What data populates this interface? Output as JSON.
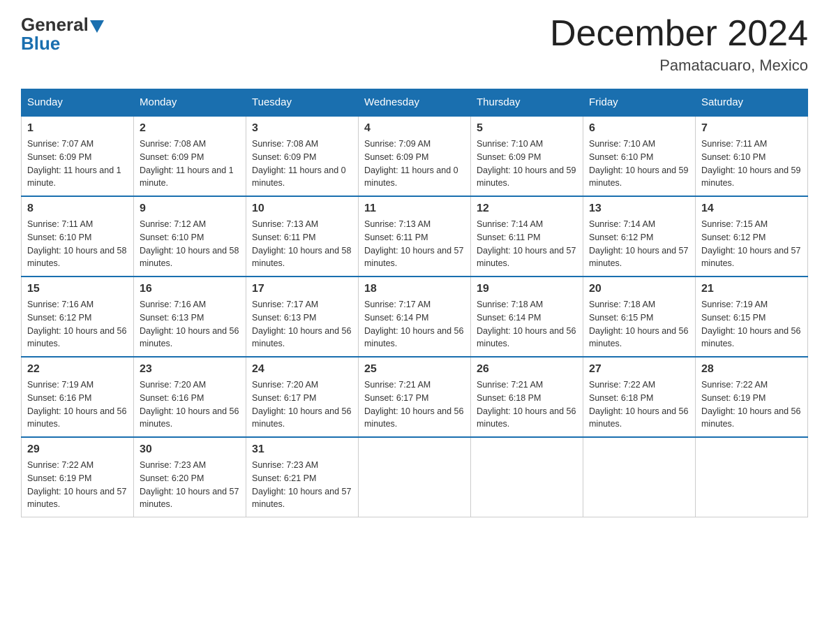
{
  "header": {
    "logo_general": "General",
    "logo_blue": "Blue",
    "month_title": "December 2024",
    "location": "Pamatacuaro, Mexico"
  },
  "days_of_week": [
    "Sunday",
    "Monday",
    "Tuesday",
    "Wednesday",
    "Thursday",
    "Friday",
    "Saturday"
  ],
  "weeks": [
    [
      {
        "day": "1",
        "sunrise": "7:07 AM",
        "sunset": "6:09 PM",
        "daylight": "11 hours and 1 minute."
      },
      {
        "day": "2",
        "sunrise": "7:08 AM",
        "sunset": "6:09 PM",
        "daylight": "11 hours and 1 minute."
      },
      {
        "day": "3",
        "sunrise": "7:08 AM",
        "sunset": "6:09 PM",
        "daylight": "11 hours and 0 minutes."
      },
      {
        "day": "4",
        "sunrise": "7:09 AM",
        "sunset": "6:09 PM",
        "daylight": "11 hours and 0 minutes."
      },
      {
        "day": "5",
        "sunrise": "7:10 AM",
        "sunset": "6:09 PM",
        "daylight": "10 hours and 59 minutes."
      },
      {
        "day": "6",
        "sunrise": "7:10 AM",
        "sunset": "6:10 PM",
        "daylight": "10 hours and 59 minutes."
      },
      {
        "day": "7",
        "sunrise": "7:11 AM",
        "sunset": "6:10 PM",
        "daylight": "10 hours and 59 minutes."
      }
    ],
    [
      {
        "day": "8",
        "sunrise": "7:11 AM",
        "sunset": "6:10 PM",
        "daylight": "10 hours and 58 minutes."
      },
      {
        "day": "9",
        "sunrise": "7:12 AM",
        "sunset": "6:10 PM",
        "daylight": "10 hours and 58 minutes."
      },
      {
        "day": "10",
        "sunrise": "7:13 AM",
        "sunset": "6:11 PM",
        "daylight": "10 hours and 58 minutes."
      },
      {
        "day": "11",
        "sunrise": "7:13 AM",
        "sunset": "6:11 PM",
        "daylight": "10 hours and 57 minutes."
      },
      {
        "day": "12",
        "sunrise": "7:14 AM",
        "sunset": "6:11 PM",
        "daylight": "10 hours and 57 minutes."
      },
      {
        "day": "13",
        "sunrise": "7:14 AM",
        "sunset": "6:12 PM",
        "daylight": "10 hours and 57 minutes."
      },
      {
        "day": "14",
        "sunrise": "7:15 AM",
        "sunset": "6:12 PM",
        "daylight": "10 hours and 57 minutes."
      }
    ],
    [
      {
        "day": "15",
        "sunrise": "7:16 AM",
        "sunset": "6:12 PM",
        "daylight": "10 hours and 56 minutes."
      },
      {
        "day": "16",
        "sunrise": "7:16 AM",
        "sunset": "6:13 PM",
        "daylight": "10 hours and 56 minutes."
      },
      {
        "day": "17",
        "sunrise": "7:17 AM",
        "sunset": "6:13 PM",
        "daylight": "10 hours and 56 minutes."
      },
      {
        "day": "18",
        "sunrise": "7:17 AM",
        "sunset": "6:14 PM",
        "daylight": "10 hours and 56 minutes."
      },
      {
        "day": "19",
        "sunrise": "7:18 AM",
        "sunset": "6:14 PM",
        "daylight": "10 hours and 56 minutes."
      },
      {
        "day": "20",
        "sunrise": "7:18 AM",
        "sunset": "6:15 PM",
        "daylight": "10 hours and 56 minutes."
      },
      {
        "day": "21",
        "sunrise": "7:19 AM",
        "sunset": "6:15 PM",
        "daylight": "10 hours and 56 minutes."
      }
    ],
    [
      {
        "day": "22",
        "sunrise": "7:19 AM",
        "sunset": "6:16 PM",
        "daylight": "10 hours and 56 minutes."
      },
      {
        "day": "23",
        "sunrise": "7:20 AM",
        "sunset": "6:16 PM",
        "daylight": "10 hours and 56 minutes."
      },
      {
        "day": "24",
        "sunrise": "7:20 AM",
        "sunset": "6:17 PM",
        "daylight": "10 hours and 56 minutes."
      },
      {
        "day": "25",
        "sunrise": "7:21 AM",
        "sunset": "6:17 PM",
        "daylight": "10 hours and 56 minutes."
      },
      {
        "day": "26",
        "sunrise": "7:21 AM",
        "sunset": "6:18 PM",
        "daylight": "10 hours and 56 minutes."
      },
      {
        "day": "27",
        "sunrise": "7:22 AM",
        "sunset": "6:18 PM",
        "daylight": "10 hours and 56 minutes."
      },
      {
        "day": "28",
        "sunrise": "7:22 AM",
        "sunset": "6:19 PM",
        "daylight": "10 hours and 56 minutes."
      }
    ],
    [
      {
        "day": "29",
        "sunrise": "7:22 AM",
        "sunset": "6:19 PM",
        "daylight": "10 hours and 57 minutes."
      },
      {
        "day": "30",
        "sunrise": "7:23 AM",
        "sunset": "6:20 PM",
        "daylight": "10 hours and 57 minutes."
      },
      {
        "day": "31",
        "sunrise": "7:23 AM",
        "sunset": "6:21 PM",
        "daylight": "10 hours and 57 minutes."
      },
      null,
      null,
      null,
      null
    ]
  ],
  "labels": {
    "sunrise": "Sunrise:",
    "sunset": "Sunset:",
    "daylight": "Daylight:"
  }
}
